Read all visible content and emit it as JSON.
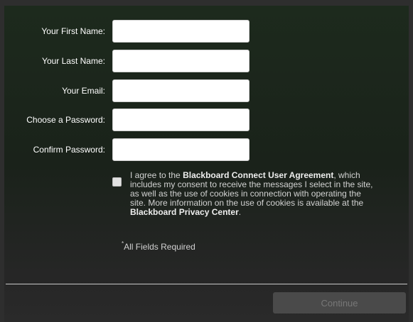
{
  "form": {
    "fields": [
      {
        "label": "Your First Name:",
        "value": "",
        "placeholder": ""
      },
      {
        "label": "Your Last Name:",
        "value": "",
        "placeholder": ""
      },
      {
        "label": "Your Email:",
        "value": "",
        "placeholder": ""
      },
      {
        "label": "Choose a Password:",
        "value": "",
        "placeholder": ""
      },
      {
        "label": "Confirm Password:",
        "value": "",
        "placeholder": ""
      }
    ],
    "agreement": {
      "checked": false,
      "text_1": "I agree to the ",
      "agreement_link": "Blackboard Connect User Agreement",
      "text_2": ", which includes my consent to receive the messages I select in the site, as well as the use of cookies in connection with operating the site. More information on the use of cookies is available at the ",
      "privacy_link": "Blackboard Privacy Center",
      "text_3": "."
    },
    "required_star": "*",
    "required_note": "All Fields Required",
    "continue_label": "Continue"
  }
}
